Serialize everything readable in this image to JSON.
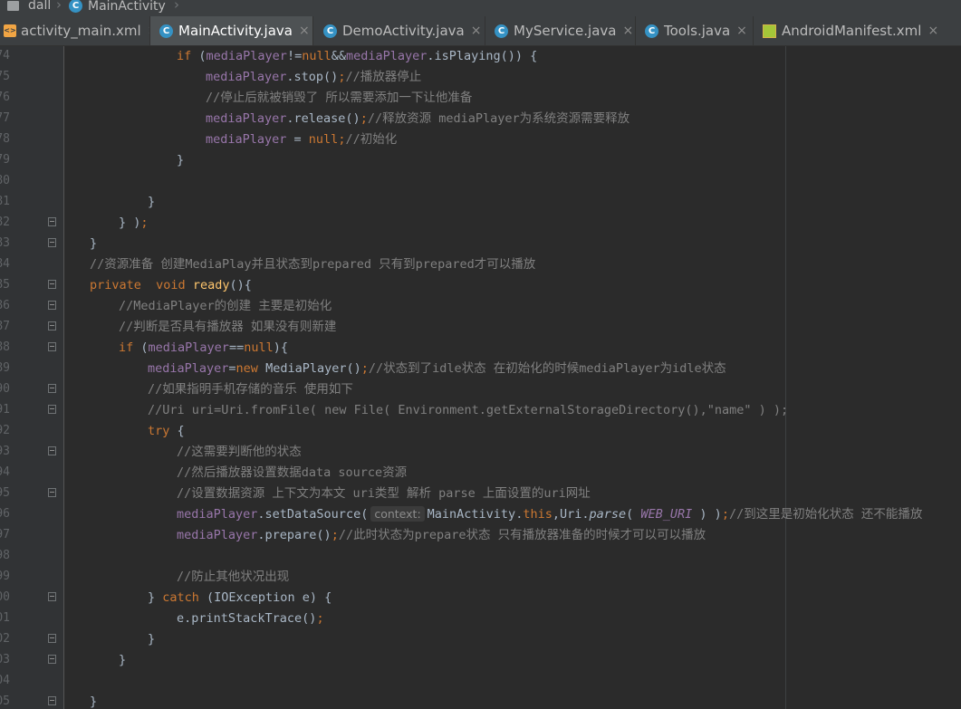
{
  "breadcrumb": {
    "module": "dall",
    "class": "MainActivity"
  },
  "tabs": [
    {
      "label": "activity_main.xml",
      "icon": "xml-file-icon",
      "active": false
    },
    {
      "label": "MainActivity.java",
      "icon": "java-class-icon",
      "active": true
    },
    {
      "label": "DemoActivity.java",
      "icon": "java-class-icon",
      "active": false
    },
    {
      "label": "MyService.java",
      "icon": "java-class-icon",
      "active": false
    },
    {
      "label": "Tools.java",
      "icon": "java-class-icon",
      "active": false
    },
    {
      "label": "AndroidManifest.xml",
      "icon": "manifest-file-icon",
      "active": false
    }
  ],
  "tab_close_glyph": "×",
  "class_icon_letter": "C",
  "colors": {
    "background": "#2b2b2b",
    "gutter": "#313335",
    "keyword": "#cc7832",
    "field": "#9876aa",
    "method_declaration": "#ffc66d",
    "comment": "#808080",
    "string": "#6a8759",
    "text": "#a9b7c6",
    "active_tab": "#4e5254"
  },
  "editor": {
    "lines": [
      {
        "num": "74",
        "text": "if (mediaPlayer!=null&&mediaPlayer.isPlaying()) {"
      },
      {
        "num": "75",
        "text": "mediaPlayer.stop();//播放器停止"
      },
      {
        "num": "76",
        "text": "//停止后就被销毁了 所以需要添加一下让他准备"
      },
      {
        "num": "77",
        "text": "mediaPlayer.release();//释放资源 mediaPlayer为系统资源需要释放"
      },
      {
        "num": "78",
        "text": "mediaPlayer = null;//初始化"
      },
      {
        "num": "79",
        "text": "}"
      },
      {
        "num": "80",
        "text": ""
      },
      {
        "num": "81",
        "text": "}"
      },
      {
        "num": "82",
        "text": "} );"
      },
      {
        "num": "83",
        "text": "}"
      },
      {
        "num": "84",
        "text": "//资源准备 创建MediaPlay并且状态到prepared 只有到prepared才可以播放"
      },
      {
        "num": "85",
        "text": "private  void ready(){"
      },
      {
        "num": "86",
        "text": "//MediaPlayer的创建 主要是初始化"
      },
      {
        "num": "87",
        "text": "//判断是否具有播放器 如果没有则新建"
      },
      {
        "num": "88",
        "text": "if (mediaPlayer==null){"
      },
      {
        "num": "89",
        "text": "mediaPlayer=new MediaPlayer();//状态到了idle状态 在初始化的时候mediaPlayer为idle状态"
      },
      {
        "num": "90",
        "text": "//如果指明手机存储的音乐 使用如下"
      },
      {
        "num": "91",
        "text": "//Uri uri=Uri.fromFile( new File( Environment.getExternalStorageDirectory(),\"name\" ) );"
      },
      {
        "num": "92",
        "text": "try {"
      },
      {
        "num": "93",
        "text": "//这需要判断他的状态"
      },
      {
        "num": "94",
        "text": "//然后播放器设置数据data source资源"
      },
      {
        "num": "95",
        "text": "//设置数据资源 上下文为本文 uri类型 解析 parse 上面设置的uri网址"
      },
      {
        "num": "96",
        "text": "mediaPlayer.setDataSource( context: MainActivity.this,Uri.parse( WEB_URI ) );//到这里是初始化状态 还不能播放"
      },
      {
        "num": "97",
        "text": "mediaPlayer.prepare();//此时状态为prepare状态 只有播放器准备的时候才可以可以播放"
      },
      {
        "num": "98",
        "text": ""
      },
      {
        "num": "99",
        "text": "//防止其他状况出现"
      },
      {
        "num": "100",
        "text": "} catch (IOException e) {"
      },
      {
        "num": "101",
        "text": "e.printStackTrace();"
      },
      {
        "num": "102",
        "text": "}"
      },
      {
        "num": "103",
        "text": "}"
      },
      {
        "num": "104",
        "text": ""
      },
      {
        "num": "105",
        "text": "}"
      }
    ]
  }
}
